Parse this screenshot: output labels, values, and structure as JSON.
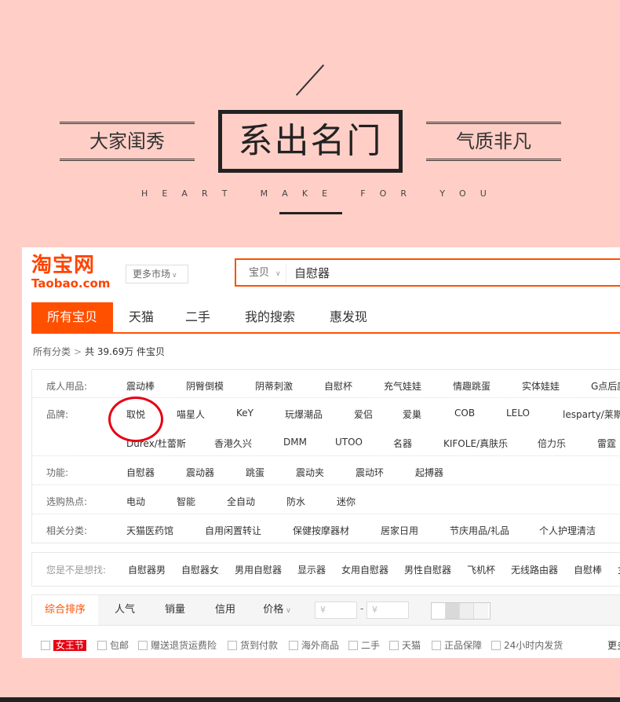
{
  "banner": {
    "left_text": "大家闺秀",
    "main_text": "系出名门",
    "right_text": "气质非凡",
    "tagline": [
      "H",
      "E",
      "A",
      "R",
      "T",
      "M",
      "A",
      "K",
      "E",
      "F",
      "O",
      "R",
      "Y",
      "O",
      "U"
    ]
  },
  "header": {
    "logo_cn": "淘宝网",
    "logo_en": "Taobao.com",
    "market_label": "更多市场",
    "search_scope": "宝贝",
    "search_query": "自慰器"
  },
  "tabs": [
    "所有宝贝",
    "天猫",
    "二手",
    "我的搜索",
    "惠发现"
  ],
  "crumbs": {
    "root": "所有分类",
    "count": "共 39.69万 件宝贝"
  },
  "filters": {
    "adult": {
      "label": "成人用品:",
      "items": [
        "震动棒",
        "阴臀倒模",
        "阴蒂刺激",
        "自慰杯",
        "充气娃娃",
        "情趣跳蛋",
        "实体娃娃",
        "G点后庭"
      ]
    },
    "brand": {
      "label": "品牌:",
      "row1": [
        "取悦",
        "喵星人",
        "KeY",
        "玩爆潮品",
        "爱侣",
        "爱巢",
        "COB",
        "LELO",
        "lesparty/莱斯帕"
      ],
      "row2": [
        "Durex/杜蕾斯",
        "香港久兴",
        "DMM",
        "UTOO",
        "名器",
        "KIFOLE/真肤乐",
        "倍力乐",
        "雷霆"
      ]
    },
    "function": {
      "label": "功能:",
      "items": [
        "自慰器",
        "震动器",
        "跳蛋",
        "震动夹",
        "震动环",
        "起搏器"
      ]
    },
    "hot": {
      "label": "选购热点:",
      "items": [
        "电动",
        "智能",
        "全自动",
        "防水",
        "迷你"
      ]
    },
    "related": {
      "label": "相关分类:",
      "items": [
        "天猫医药馆",
        "自用闲置转让",
        "保健按摩器材",
        "居家日用",
        "节庆用品/礼品",
        "个人护理清洁"
      ]
    }
  },
  "suggest": {
    "label": "您是不是想找:",
    "items": [
      "自慰器男",
      "自慰器女",
      "男用自慰器",
      "显示器",
      "女用自慰器",
      "男性自慰器",
      "飞机杯",
      "无线路由器",
      "自慰棒",
      "女"
    ]
  },
  "sort": {
    "items": [
      "综合排序",
      "人气",
      "销量",
      "信用",
      "价格"
    ],
    "price_from": "¥",
    "price_to": "¥",
    "dash": "-"
  },
  "checks": {
    "items": [
      "女王节",
      "包邮",
      "赠送退货运费险",
      "货到付款",
      "海外商品",
      "二手",
      "天猫",
      "正品保障",
      "24小时内发货"
    ],
    "more": "更多"
  },
  "colors": {
    "accent": "#ff5000",
    "banner_bg": "#ffcfc7",
    "highlight": "#e60012"
  }
}
